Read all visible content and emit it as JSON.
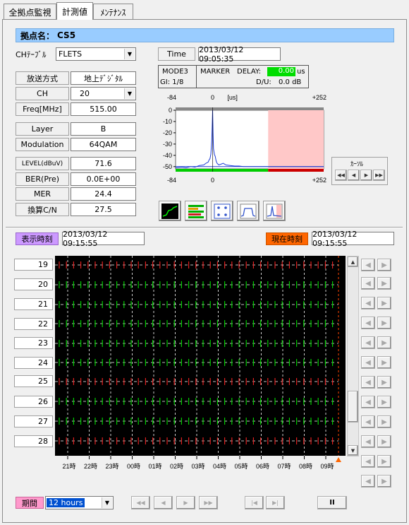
{
  "tabs": [
    {
      "label": "全拠点監視"
    },
    {
      "label": "計測値"
    },
    {
      "label": "ﾒﾝﾃﾅﾝｽ"
    }
  ],
  "site": {
    "label": "拠点名：",
    "name": "CS5"
  },
  "ch_table": {
    "label": "CHﾃｰﾌﾞﾙ",
    "value": "FLETS"
  },
  "time": {
    "label": "Time",
    "value": "2013/03/12 09:05:35"
  },
  "params": {
    "broadcast": {
      "label": "放送方式",
      "value": "地上ﾃﾞｼﾞﾀﾙ"
    },
    "ch": {
      "label": "CH",
      "value": "20"
    },
    "freq": {
      "label": "Freq[MHz]",
      "value": "515.00"
    },
    "layer": {
      "label": "Layer",
      "value": "B"
    },
    "modulation": {
      "label": "Modulation",
      "value": "64QAM"
    },
    "level": {
      "label": "LEVEL(dBuV)",
      "value": "71.6"
    },
    "ber": {
      "label": "BER(Pre)",
      "value": "0.0E+00"
    },
    "mer": {
      "label": "MER",
      "value": "24.4"
    },
    "cn": {
      "label": "換算C/N",
      "value": "27.5"
    }
  },
  "info": {
    "mode": "MODE3",
    "gi": "GI: 1/8",
    "marker": "MARKER",
    "delay_label": "DELAY:",
    "delay_value": "0.00",
    "delay_unit": "us",
    "du_label": "D/U:",
    "du_value": "0.0 dB"
  },
  "cursor": {
    "label": "ｶｰｿﾙ"
  },
  "chart_data": {
    "type": "line",
    "title": "",
    "x_unit": "[us]",
    "x_top_labels": [
      "-84",
      "0",
      "+252"
    ],
    "x_bottom_labels": [
      "-84",
      "0",
      "+252"
    ],
    "y_ticks": [
      "0",
      "-10",
      "-20",
      "-30",
      "-40",
      "-50"
    ],
    "xlim": [
      -84,
      252
    ],
    "ylim": [
      -52,
      0
    ],
    "grid": false,
    "series": [
      {
        "x": [
          -84,
          -70,
          -60,
          -50,
          -40,
          -30,
          -20,
          -15,
          -10,
          -8,
          -6,
          -4,
          -2,
          -1,
          0,
          1,
          2,
          4,
          6,
          8,
          10,
          14,
          18,
          24,
          30,
          40,
          50,
          60,
          70,
          80,
          100,
          140,
          180,
          252
        ],
        "y": [
          -51,
          -50.5,
          -51,
          -50,
          -50.5,
          -49,
          -48.5,
          -47,
          -46,
          -44,
          -43,
          -39,
          -27,
          -15,
          0,
          -20,
          -34,
          -39,
          -41,
          -45,
          -47,
          -48.5,
          -48,
          -47,
          -48.5,
          -49,
          -49.5,
          -49.5,
          -50,
          -50,
          -50,
          -50,
          -50,
          -50
        ]
      }
    ]
  },
  "display_time": {
    "label": "表示時刻",
    "value": "2013/03/12 09:15:55"
  },
  "current_time": {
    "label": "現在時刻",
    "value": "2013/03/12 09:15:55"
  },
  "channels": [
    "19",
    "20",
    "21",
    "22",
    "23",
    "24",
    "25",
    "26",
    "27",
    "28"
  ],
  "time_axis": [
    "21時",
    "22時",
    "23時",
    "00時",
    "01時",
    "02時",
    "03時",
    "04時",
    "05時",
    "06時",
    "07時",
    "08時",
    "09時"
  ],
  "status_colors": {
    "ok": "#00cc00",
    "ng": "#e02020",
    "background": "#000000"
  },
  "row_status": [
    "ng",
    "ok",
    "ok",
    "ok",
    "ok",
    "ok",
    "ng",
    "ok",
    "ok",
    "ng"
  ],
  "period": {
    "label": "期間",
    "value": "12 hours"
  },
  "playback": {
    "first": "◀◀",
    "prev": "◀",
    "next": "▶",
    "last": "▶▶",
    "begin": "|◀",
    "end": "▶|",
    "pause": "II"
  },
  "nav": {
    "left": "◀",
    "right": "▶"
  },
  "cursor_buttons": {
    "first": "◀◀",
    "prev": "◀",
    "next": "▶",
    "last": "▶▶"
  },
  "icons": [
    "trend-icon",
    "bars-icon",
    "constellation-icon",
    "spectrum-icon",
    "delay-profile-icon"
  ]
}
